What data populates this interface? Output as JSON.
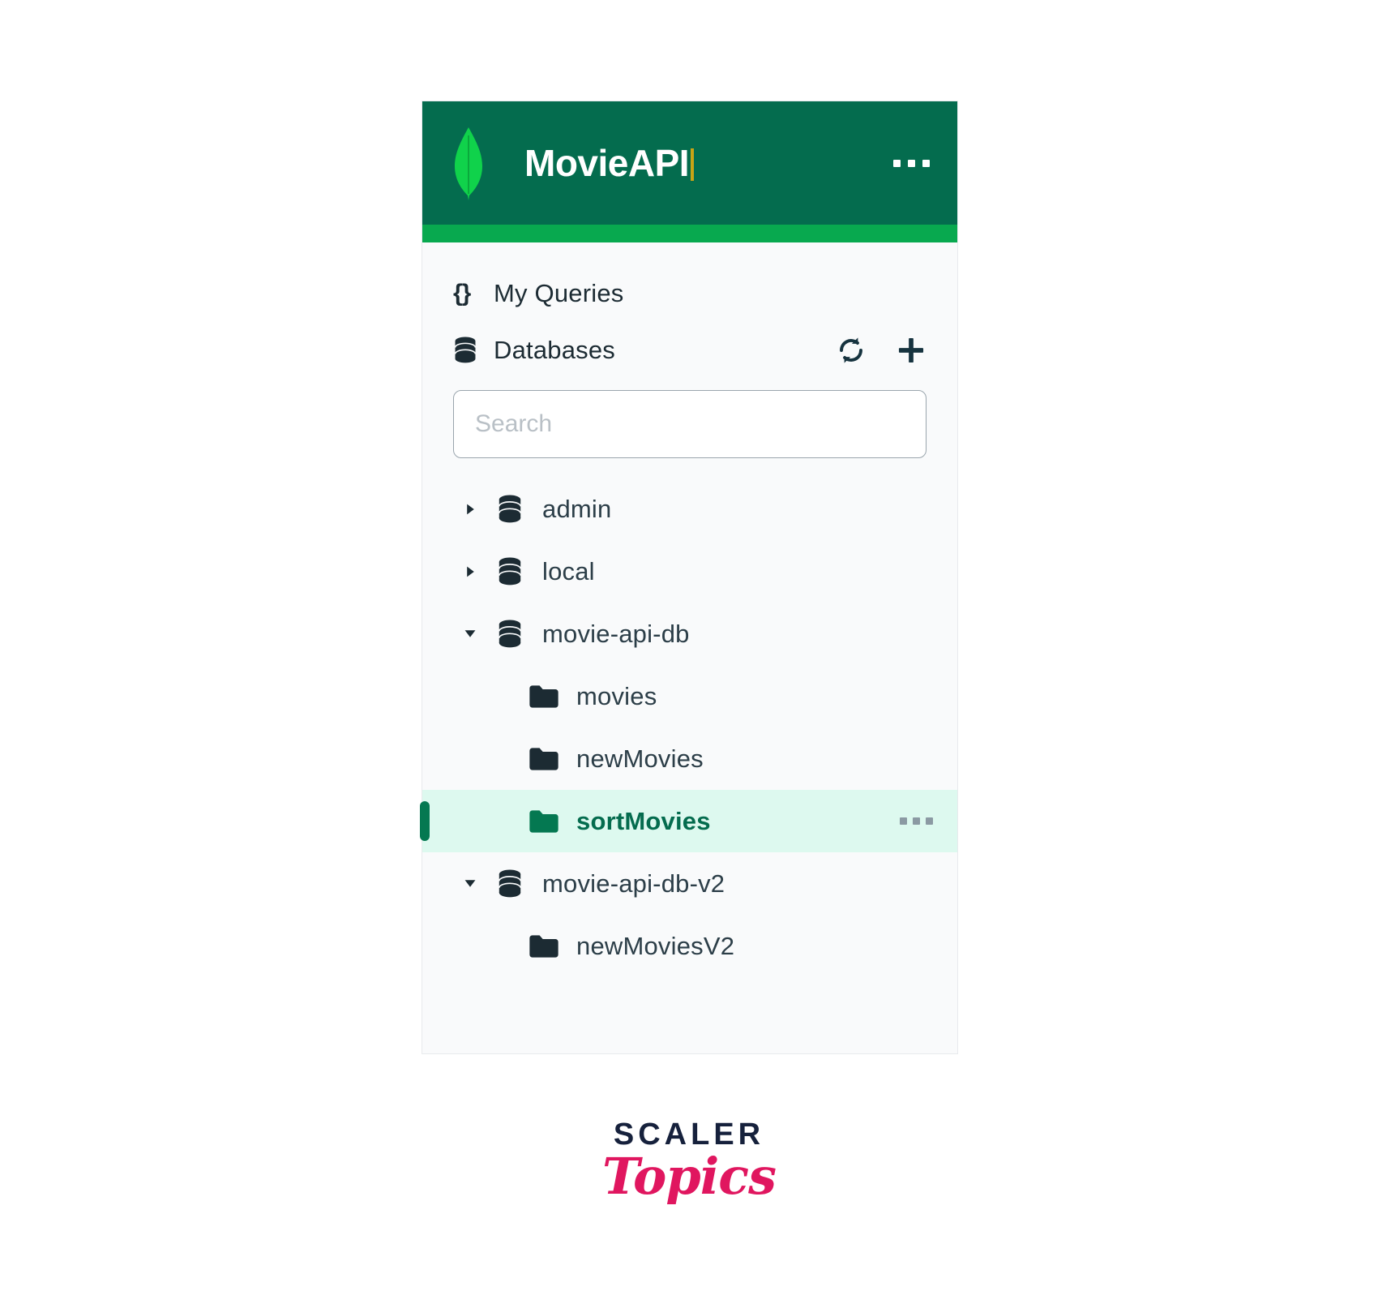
{
  "app": {
    "title": "MovieAPI",
    "logo_icon": "mongodb-leaf-icon",
    "header_menu_icon": "ellipsis-icon",
    "brand_color": "#046c4e",
    "accent_color": "#08a94f",
    "active_row_bg": "#ddf9ef",
    "active_text_color": "#046c4e"
  },
  "nav": {
    "my_queries": {
      "label": "My Queries",
      "icon": "braces-icon",
      "icon_glyph": "{}"
    },
    "databases": {
      "label": "Databases",
      "icon": "database-icon",
      "refresh_icon": "refresh-icon",
      "add_icon": "plus-icon"
    }
  },
  "search": {
    "placeholder": "Search",
    "value": ""
  },
  "tree": [
    {
      "name": "admin",
      "type": "database",
      "icon": "database-icon",
      "expanded": false,
      "twisty": "chevron-right-icon",
      "children": []
    },
    {
      "name": "local",
      "type": "database",
      "icon": "database-icon",
      "expanded": false,
      "twisty": "chevron-right-icon",
      "children": []
    },
    {
      "name": "movie-api-db",
      "type": "database",
      "icon": "database-icon",
      "expanded": true,
      "twisty": "chevron-down-icon",
      "children": [
        {
          "name": "movies",
          "type": "collection",
          "icon": "folder-icon",
          "active": false
        },
        {
          "name": "newMovies",
          "type": "collection",
          "icon": "folder-icon",
          "active": false
        },
        {
          "name": "sortMovies",
          "type": "collection",
          "icon": "folder-icon",
          "active": true,
          "row_menu_icon": "ellipsis-icon"
        }
      ]
    },
    {
      "name": "movie-api-db-v2",
      "type": "database",
      "icon": "database-icon",
      "expanded": true,
      "twisty": "chevron-down-icon",
      "children": [
        {
          "name": "newMoviesV2",
          "type": "collection",
          "icon": "folder-icon",
          "active": false
        }
      ]
    }
  ],
  "watermark": {
    "line1": "SCALER",
    "line2": "Topics",
    "line1_color": "#16213c",
    "line2_color": "#e0165f"
  }
}
